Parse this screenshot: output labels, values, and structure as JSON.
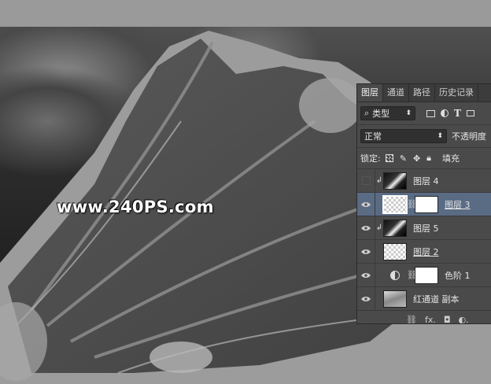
{
  "watermark": "www.240PS.com",
  "panel": {
    "tabs": [
      {
        "label": "图层",
        "active": true
      },
      {
        "label": "通道",
        "active": false
      },
      {
        "label": "路径",
        "active": false
      },
      {
        "label": "历史记录",
        "active": false
      }
    ],
    "filter": {
      "label": "类型",
      "search_icon": "search-icon",
      "chevron": "⬍"
    },
    "blend_mode": "正常",
    "opacity_label": "不透明度",
    "lock_label": "锁定:",
    "fill_label": "填充",
    "layers": [
      {
        "name": "图层 4",
        "visible": false,
        "clipped": true,
        "thumb": "dark",
        "underline": false,
        "selected": false,
        "mask": false,
        "adjustment": false
      },
      {
        "name": "图层 3",
        "visible": true,
        "clipped": false,
        "thumb": "checker",
        "underline": true,
        "selected": true,
        "mask": true,
        "adjustment": false
      },
      {
        "name": "图层 5",
        "visible": true,
        "clipped": true,
        "thumb": "dark",
        "underline": false,
        "selected": false,
        "mask": false,
        "adjustment": false
      },
      {
        "name": "图层 2",
        "visible": true,
        "clipped": false,
        "thumb": "checker",
        "underline": true,
        "selected": false,
        "mask": false,
        "adjustment": false
      },
      {
        "name": "色阶 1",
        "visible": true,
        "clipped": false,
        "thumb": "adj",
        "underline": false,
        "selected": false,
        "mask": true,
        "adjustment": true
      },
      {
        "name": "红通道 副本",
        "visible": true,
        "clipped": false,
        "thumb": "gray",
        "underline": false,
        "selected": false,
        "mask": false,
        "adjustment": false
      }
    ],
    "footer": [
      "⛓",
      "fx.",
      "◘",
      "◐."
    ]
  }
}
